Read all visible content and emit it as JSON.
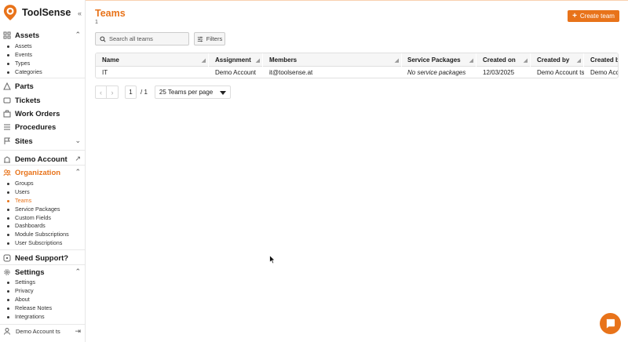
{
  "brand": {
    "name": "ToolSense",
    "accent": "#e8731a"
  },
  "sidebar": {
    "collapse_icon": "double-chevron-left-icon",
    "assets": {
      "label": "Assets",
      "items": [
        "Assets",
        "Events",
        "Types",
        "Categories"
      ]
    },
    "parts": {
      "label": "Parts"
    },
    "tickets": {
      "label": "Tickets"
    },
    "work_orders": {
      "label": "Work Orders"
    },
    "procedures": {
      "label": "Procedures"
    },
    "sites": {
      "label": "Sites"
    },
    "demo_account": {
      "label": "Demo Account"
    },
    "organization": {
      "label": "Organization",
      "items": [
        "Groups",
        "Users",
        "Teams",
        "Service Packages",
        "Custom Fields",
        "Dashboards",
        "Module Subscriptions",
        "User Subscriptions"
      ],
      "active_item": "Teams"
    },
    "support": {
      "label": "Need Support?"
    },
    "settings": {
      "label": "Settings",
      "items": [
        "Settings",
        "Privacy",
        "About",
        "Release Notes",
        "Integrations"
      ]
    },
    "footer_user": "Demo Account ts"
  },
  "page": {
    "title": "Teams",
    "count": "1",
    "create_label": "Create team"
  },
  "toolbar": {
    "search_placeholder": "Search all teams",
    "filters_label": "Filters"
  },
  "table": {
    "columns": [
      "Name",
      "Assignment",
      "Members",
      "Service Packages",
      "Created on",
      "Created by",
      "Created b"
    ],
    "rows": [
      {
        "name": "IT",
        "assignment": "Demo Account",
        "members": "it@toolsense.at",
        "service_packages": "No service packages",
        "created_on": "12/03/2025",
        "created_by": "Demo Account ts",
        "created_b": "Demo Acco"
      }
    ]
  },
  "pagination": {
    "current_page": "1",
    "total": "/ 1",
    "per_page": "25 Teams per page"
  }
}
